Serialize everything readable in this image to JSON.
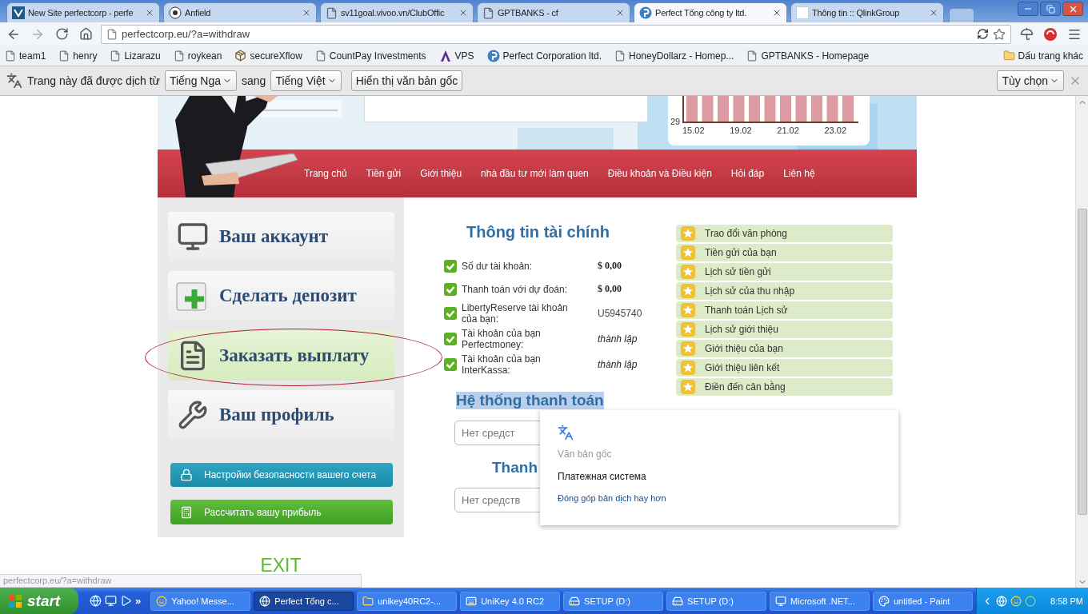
{
  "tabs": [
    {
      "title": "New Site perfectcorp - perfe",
      "kind": "site",
      "selected": false
    },
    {
      "title": "Anfield",
      "kind": "ball",
      "selected": false
    },
    {
      "title": "sv11goal.vivoo.vn/ClubOffic",
      "kind": "page",
      "selected": false
    },
    {
      "title": "GPTBANKS - cf",
      "kind": "page",
      "selected": false
    },
    {
      "title": "Perfect Tổng công ty ltd.",
      "kind": "perfect",
      "selected": true
    },
    {
      "title": "Thông tin :: QlinkGroup",
      "kind": "blank",
      "selected": false
    }
  ],
  "address_bar": {
    "url": "perfectcorp.eu/?a=withdraw"
  },
  "bookmarks": [
    {
      "label": "team1",
      "kind": "page"
    },
    {
      "label": "henry",
      "kind": "page"
    },
    {
      "label": "Lizarazu",
      "kind": "page"
    },
    {
      "label": "roykean",
      "kind": "page"
    },
    {
      "label": "secureXflow",
      "kind": "box"
    },
    {
      "label": "CountPay Investments",
      "kind": "page"
    },
    {
      "label": "VPS",
      "kind": "letter"
    },
    {
      "label": "Perfect Corporation ltd.",
      "kind": "perfect"
    },
    {
      "label": "HoneyDollarz - Homep...",
      "kind": "page"
    },
    {
      "label": "GPTBANKS - Homepage",
      "kind": "page"
    }
  ],
  "other_bookmarks": "Dấu trang khác",
  "translate_bar": {
    "prefix": "Trang này đã được dịch từ",
    "from": "Tiếng Nga",
    "middle": "sang",
    "to": "Tiếng Việt",
    "show_original": "Hiển thị văn bản gốc",
    "options": "Tùy chọn"
  },
  "header_chart": {
    "y_label": "29",
    "x_labels": [
      "15.02",
      "19.02",
      "21.02",
      "23.02"
    ]
  },
  "nav": [
    "Trang chủ",
    "Tiền gửi",
    "Giới thiệu",
    "nhà đầu tư mới làm quen",
    "Điều khoản và Điều kiện",
    "Hỏi đáp",
    "Liên hệ"
  ],
  "side_menu": [
    {
      "label": "Ваш аккаунт",
      "kind": "monitor",
      "selected": false,
      "circled": false
    },
    {
      "label": "Сделать депозит",
      "kind": "plus",
      "selected": false,
      "circled": false
    },
    {
      "label": "Заказать выплату",
      "kind": "document",
      "selected": true,
      "circled": true
    },
    {
      "label": "Ваш профиль",
      "kind": "tools",
      "selected": false,
      "circled": false
    }
  ],
  "side_buttons": [
    {
      "label": "Настройки безопасности вашего счета",
      "kind": "security"
    },
    {
      "label": "Рассчитать вашу прибыль",
      "kind": "calc"
    }
  ],
  "exit": "EXIT",
  "finance": {
    "title": "Thông tin tài chính",
    "rows": [
      {
        "label": "Số dư tài khoản:",
        "value": "$ 0,00",
        "kind": "amount"
      },
      {
        "label": "Thanh toán với dự đoán:",
        "value": "$ 0,00",
        "kind": "amount"
      },
      {
        "label": "LibertyReserve tài khoản của bạn:",
        "value": "U5945740",
        "kind": "plain"
      },
      {
        "label": "Tài khoản của bạn Perfectmoney:",
        "value": "thành lập",
        "kind": "status"
      },
      {
        "label": "Tài khoản của bạn InterKassa:",
        "value": "thành lập",
        "kind": "status"
      }
    ]
  },
  "links": [
    "Trao đổi văn phòng",
    "Tiền gửi của bạn",
    "Lịch sử tiền gửi",
    "Lịch sử của thu nhập",
    "Thanh toán Lịch sử",
    "Lịch sử giới thiệu",
    "Giới thiệu của bạn",
    "Giới thiệu liên kết",
    "Điền đến cân bằng"
  ],
  "payment": {
    "title": "Hệ thống thanh toán",
    "title_selected": true,
    "field_1": {
      "placeholder": "Нет средст"
    },
    "subtitle": "Thanh",
    "field_2": {
      "placeholder": "Нет средств"
    }
  },
  "translate_popup": {
    "original_label": "Văn bản gốc",
    "original_text": "Платежная система",
    "contribute": "Đóng góp bản dịch hay hơn"
  },
  "status_bubble": "perfectcorp.eu/?a=withdraw",
  "taskbar": {
    "start": "start",
    "more": "»",
    "items": [
      {
        "label": "Yahoo! Messe...",
        "kind": "smile",
        "selected": false
      },
      {
        "label": "Perfect Tổng c...",
        "kind": "globe",
        "selected": true
      },
      {
        "label": "unikey40RC2-...",
        "kind": "folder",
        "selected": false
      },
      {
        "label": "UniKey 4.0 RC2",
        "kind": "keyboard",
        "selected": false
      },
      {
        "label": "SETUP (D:)",
        "kind": "drive",
        "selected": false
      },
      {
        "label": "SETUP (D:)",
        "kind": "drive",
        "selected": false
      },
      {
        "label": "Microsoft .NET...",
        "kind": "monitor",
        "selected": false
      },
      {
        "label": "untitled - Paint",
        "kind": "paint",
        "selected": false
      }
    ],
    "clock": "8:58 PM"
  }
}
